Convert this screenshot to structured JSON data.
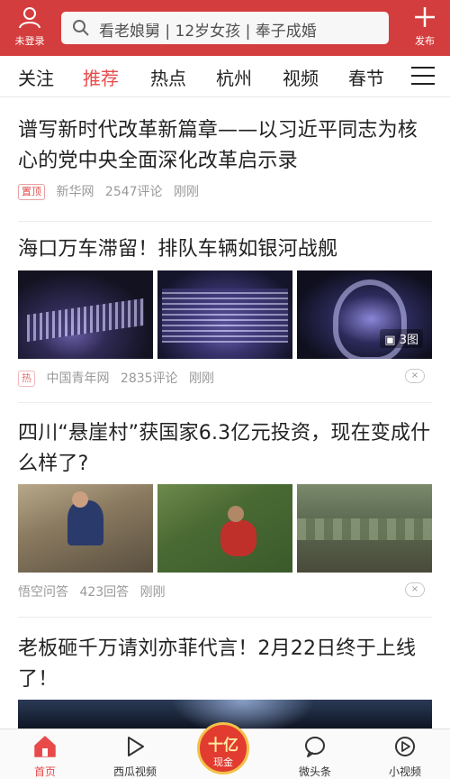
{
  "header": {
    "login_label": "未登录",
    "search_placeholder": "看老娘舅 | 12岁女孩 | 奉子成婚",
    "publish_label": "发布"
  },
  "tabs": [
    {
      "label": "关注"
    },
    {
      "label": "推荐"
    },
    {
      "label": "热点"
    },
    {
      "label": "杭州"
    },
    {
      "label": "视频"
    },
    {
      "label": "春节"
    }
  ],
  "active_tab": "推荐",
  "feed": [
    {
      "title": "谱写新时代改革新篇章——以习近平同志为核心的党中央全面深化改革启示录",
      "badge": "置顶",
      "source": "新华网",
      "comments": "2547评论",
      "time": "刚刚"
    },
    {
      "title": "海口万车滞留！排队车辆如银河战舰",
      "image_count": "3图",
      "badge": "热",
      "source": "中国青年网",
      "comments": "2835评论",
      "time": "刚刚",
      "dislike": "×"
    },
    {
      "title": "四川“悬崖村”获国家6.3亿元投资，现在变成什么样了?",
      "source": "悟空问答",
      "comments": "423回答",
      "time": "刚刚",
      "dislike": "×"
    },
    {
      "title": "老板砸千万请刘亦菲代言！2月22日终于上线了！"
    }
  ],
  "bottom_nav": {
    "home": "首页",
    "video": "西瓜视频",
    "cash_big": "十亿",
    "cash_small": "现金",
    "weitoutiao": "微头条",
    "small_video": "小视频"
  },
  "colors": {
    "brand_red": "#d43d3d",
    "active_red": "#e84a4a"
  }
}
